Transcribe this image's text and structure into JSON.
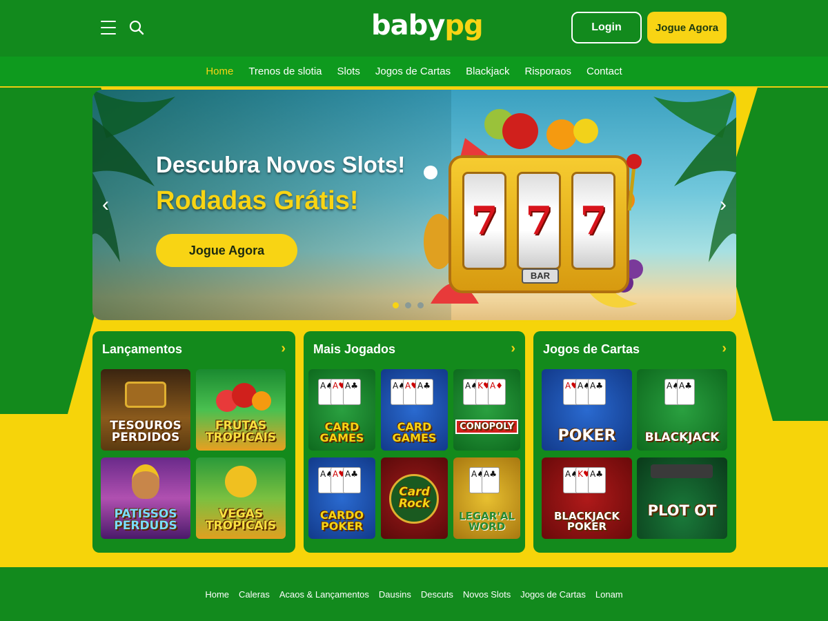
{
  "header": {
    "logo_part1": "baby",
    "logo_part2": "pg",
    "login_label": "Login",
    "play_label": "Jogue Agora"
  },
  "nav": {
    "items": [
      "Home",
      "Trenos de slotia",
      "Slots",
      "Jogos de Cartas",
      "Blackjack",
      "Risporaos",
      "Contact"
    ],
    "active": "Home"
  },
  "hero": {
    "title": "Descubra Novos Slots!",
    "subtitle": "Rodadas Grátis!",
    "button": "Jogue Agora",
    "reel_symbols": [
      "7",
      "7",
      "7"
    ],
    "bar_label": "BAR",
    "slide_count": 3,
    "active_slide": 1
  },
  "panels": [
    {
      "title": "Lançamentos",
      "games": [
        "TESOUROS PERDIDOS",
        "FRUTAS TROPICAIS",
        "PATISSOS PERDUDS",
        "VEGAS TROPICAIS"
      ]
    },
    {
      "title": "Mais Jogados",
      "games": [
        "CARD GAMES",
        "CARD GAMES",
        "CONOPOLY",
        "CARDO POKER",
        "Card Rock",
        "LEGAR'AL WORD"
      ]
    },
    {
      "title": "Jogos de Cartas",
      "games": [
        "POKER",
        "BLACKJACK",
        "BLACKJACK POKER",
        "PLOT OT"
      ]
    }
  ],
  "footer": {
    "links": [
      "Home",
      "Caleras",
      "Acaos & Lançamentos",
      "Dausins",
      "Descuts",
      "Novos Slots",
      "Jogos de Cartas",
      "Lonam"
    ]
  },
  "colors": {
    "brand_green": "#128a1d",
    "brand_yellow": "#f8d414"
  }
}
